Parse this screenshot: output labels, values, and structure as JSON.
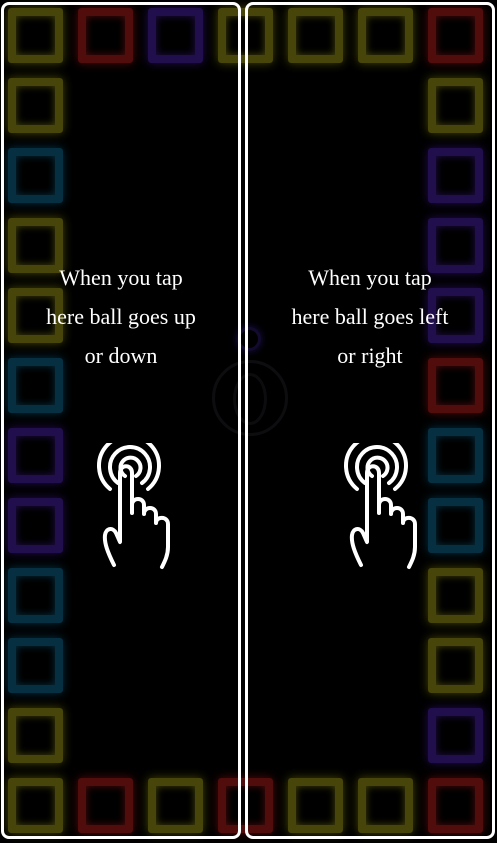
{
  "colors": {
    "red": "#b31b1b",
    "yellow": "#9e9a14",
    "blue": "#0e6b93",
    "purple": "#4b1fa8",
    "hint_text": "#ffffff",
    "zone_border": "#ffffff"
  },
  "board": {
    "top_row": [
      "yellow",
      "red",
      "purple",
      "yellow",
      "yellow",
      "yellow",
      "red"
    ],
    "bottom_row": [
      "yellow",
      "red",
      "yellow",
      "red",
      "yellow",
      "yellow",
      "red"
    ],
    "left_column": [
      "yellow",
      "blue",
      "yellow",
      "yellow",
      "blue",
      "purple",
      "purple",
      "blue",
      "blue",
      "yellow"
    ],
    "right_column": [
      "yellow",
      "purple",
      "purple",
      "purple",
      "red",
      "blue",
      "blue",
      "yellow",
      "yellow",
      "purple"
    ]
  },
  "tutorial": {
    "left_zone": {
      "hint_lines": [
        "When you tap",
        "here ball goes up",
        "or down"
      ],
      "icon": "tap-hand-icon"
    },
    "right_zone": {
      "hint_lines": [
        "When you tap",
        "here ball goes left",
        "or right"
      ],
      "icon": "tap-hand-icon"
    }
  }
}
